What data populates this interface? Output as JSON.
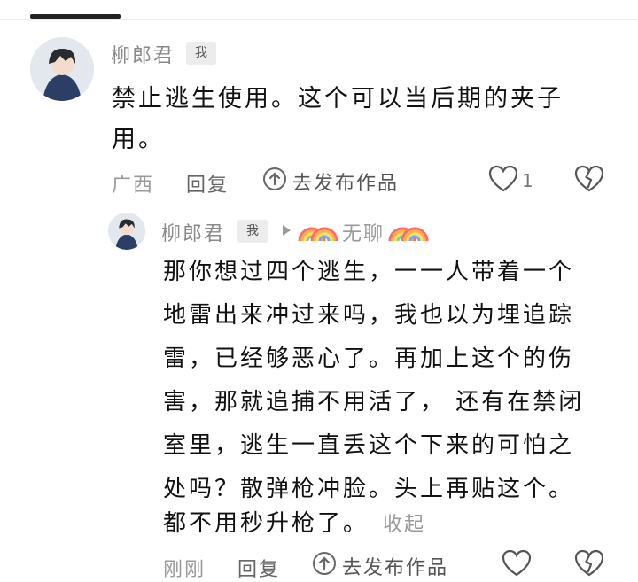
{
  "comment": {
    "author": "柳郎君",
    "badge": "我",
    "text_line1": "禁止逃生使用。这个可以当后期的夹子",
    "text_line2": "用。",
    "location": "广西",
    "reply_label": "回复",
    "publish_label": "去发布作品",
    "like_count": "1"
  },
  "reply": {
    "author": "柳郎君",
    "badge": "我",
    "reply_to": "无聊",
    "lines": [
      "那你想过四个逃生，一一人带着一个",
      "地雷出来冲过来吗，我也以为埋追踪",
      "雷，已经够恶心了。再加上这个的伤",
      "害，那就追捕不用活了， 还有在禁闭",
      "室里，逃生一直丢这个下来的可怕之",
      "处吗？散弹枪冲脸。头上再贴这个。",
      "都不用秒升枪了。"
    ],
    "collapse_label": "收起",
    "time": "刚刚",
    "reply_label": "回复",
    "publish_label": "去发布作品"
  },
  "icons": [
    "upload-circle-icon",
    "heart-icon",
    "broken-heart-icon",
    "play-arrow-icon",
    "rainbow-icon"
  ],
  "colors": {
    "text": "#111111",
    "meta": "#9a9a9a",
    "badge_bg": "#ececec"
  }
}
